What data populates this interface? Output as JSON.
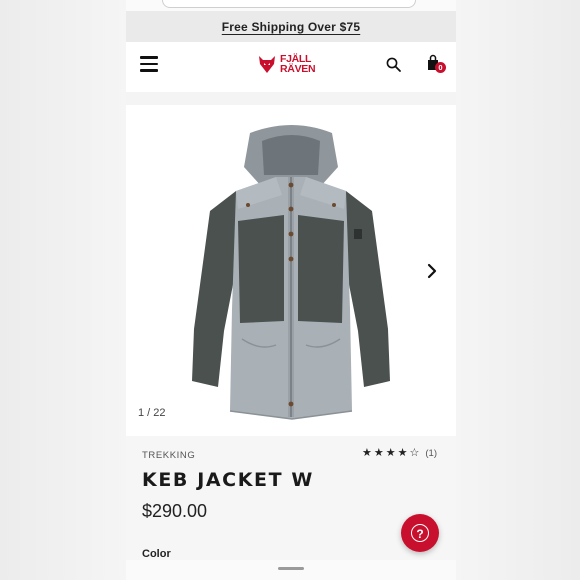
{
  "promo": {
    "text": "Free Shipping Over $75"
  },
  "header": {
    "logo_line1": "FJÄLL",
    "logo_line2": "RÄVEN",
    "cart_count": "0",
    "menu_icon": "hamburger-menu-icon",
    "search_icon": "search-icon",
    "cart_icon": "shopping-bag-icon"
  },
  "gallery": {
    "counter": "1 / 22",
    "next_icon": "chevron-right-icon"
  },
  "product": {
    "category": "TREKKING",
    "name": "KEB JACKET W",
    "price": "$290.00",
    "rating_value": 4,
    "rating_max": 5,
    "review_count": "(1)",
    "color_label": "Color"
  },
  "colors": {
    "brand": "#c8102e",
    "jacket_light": "#a9b0b6",
    "jacket_dark": "#4a514f"
  },
  "help": {
    "icon": "question-help-icon"
  }
}
